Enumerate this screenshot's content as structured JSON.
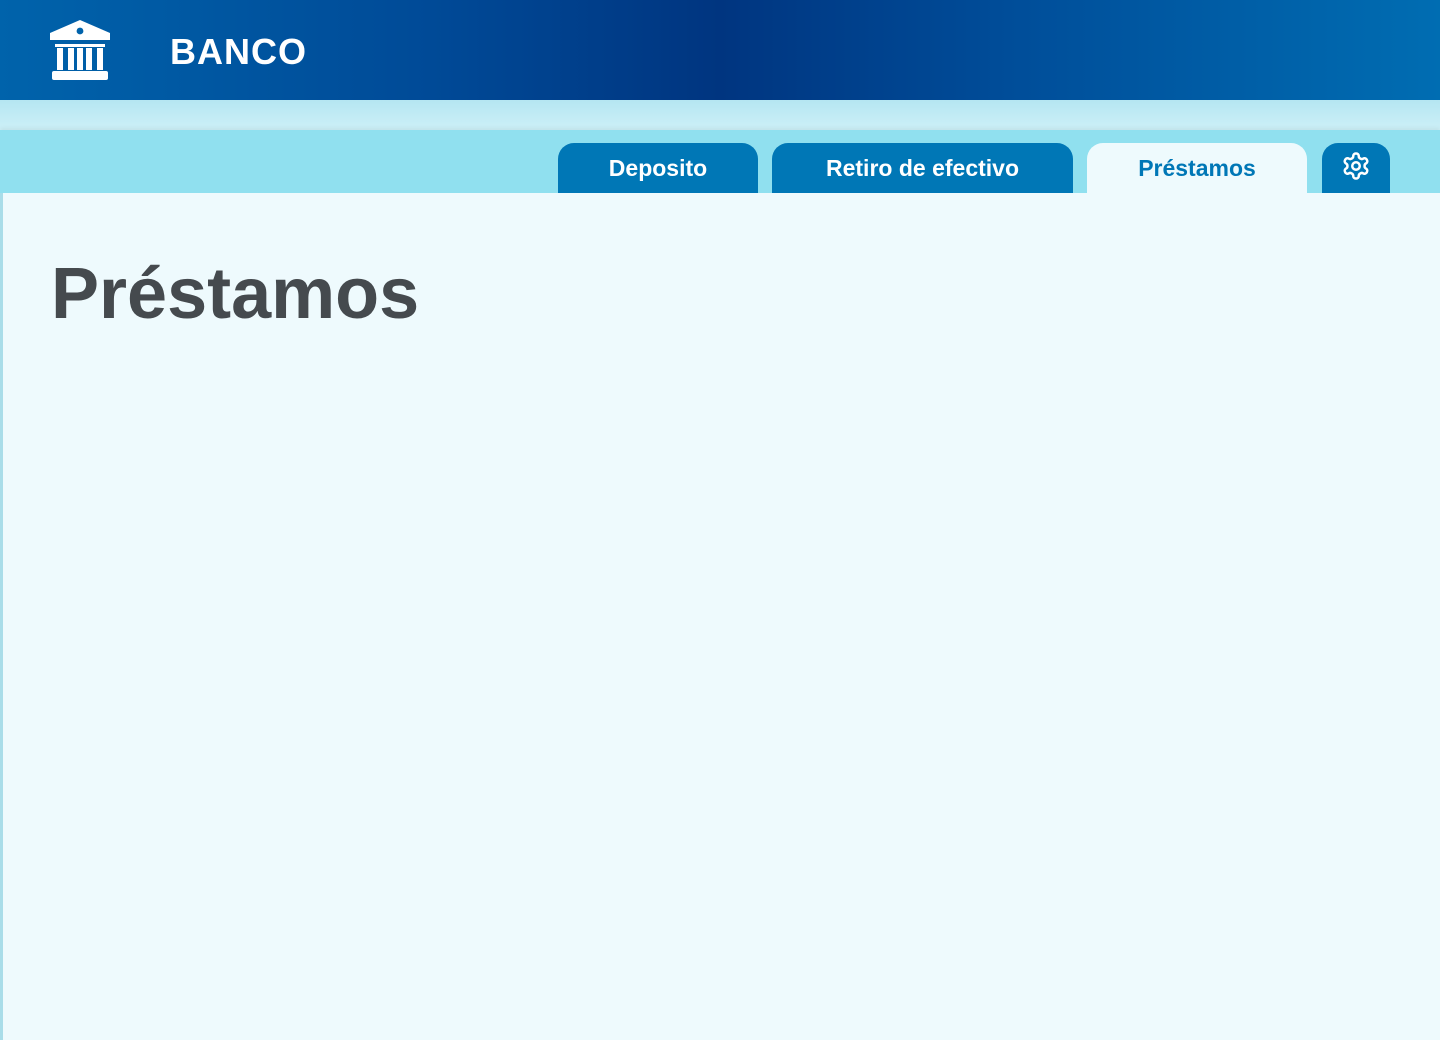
{
  "header": {
    "brand": "BANCO",
    "logo_icon": "bank-building-icon",
    "colors": {
      "gradient_left": "#0063ab",
      "gradient_mid": "#003580",
      "gradient_right": "#006db2"
    }
  },
  "tabs": {
    "items": [
      {
        "label": "Deposito",
        "active": false
      },
      {
        "label": "Retiro de efectivo",
        "active": false
      },
      {
        "label": "Préstamos",
        "active": true
      }
    ],
    "settings_icon": "gear-icon",
    "colors": {
      "tab_bar": "#90e0ef",
      "tab": "#0077b6",
      "active_tab_bg": "#eefafd"
    }
  },
  "main": {
    "title": "Préstamos"
  }
}
